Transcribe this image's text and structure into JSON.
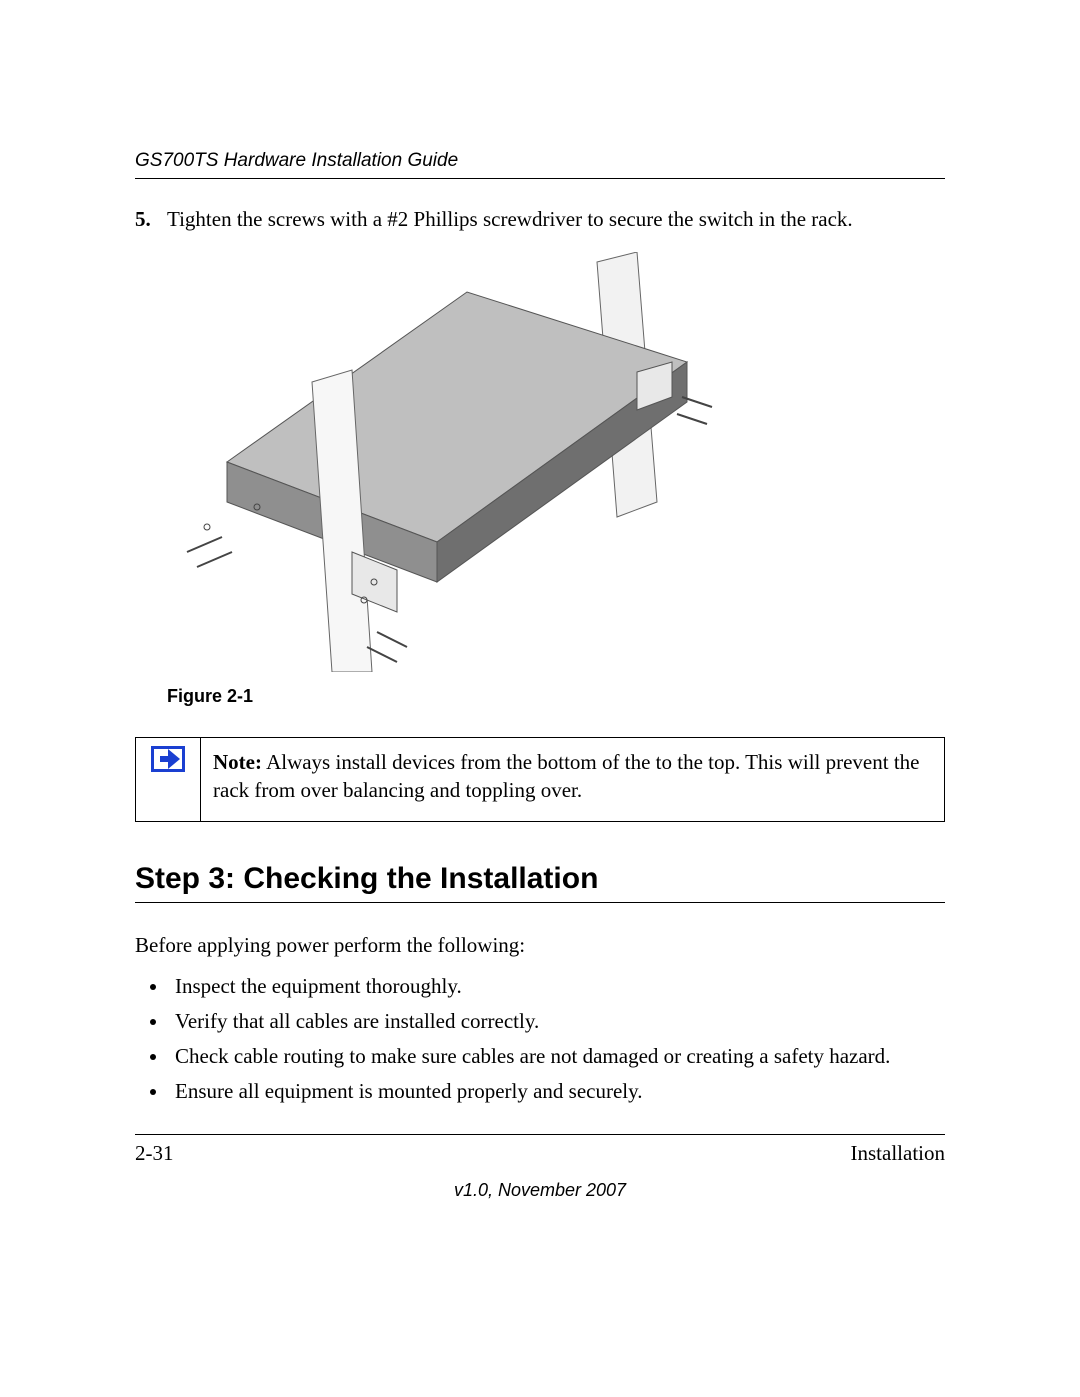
{
  "header": {
    "title": "GS700TS Hardware Installation Guide"
  },
  "step": {
    "number": "5.",
    "text": "Tighten the screws with a #2 Phillips screwdriver to secure the switch in the rack."
  },
  "figure": {
    "caption": "Figure 2-1"
  },
  "note": {
    "label": "Note:",
    "text": " Always install devices from the bottom of the to the top. This will prevent the rack from over balancing and toppling over."
  },
  "section": {
    "heading": "Step 3: Checking the Installation"
  },
  "intro": "Before applying power perform the following:",
  "bullets": [
    "Inspect the equipment thoroughly.",
    "Verify that all cables are installed correctly.",
    "Check cable routing to make sure cables are not damaged or creating a safety hazard.",
    "Ensure all equipment is mounted properly and securely."
  ],
  "footer": {
    "left": "2-31",
    "right": "Installation",
    "version": "v1.0, November 2007"
  }
}
